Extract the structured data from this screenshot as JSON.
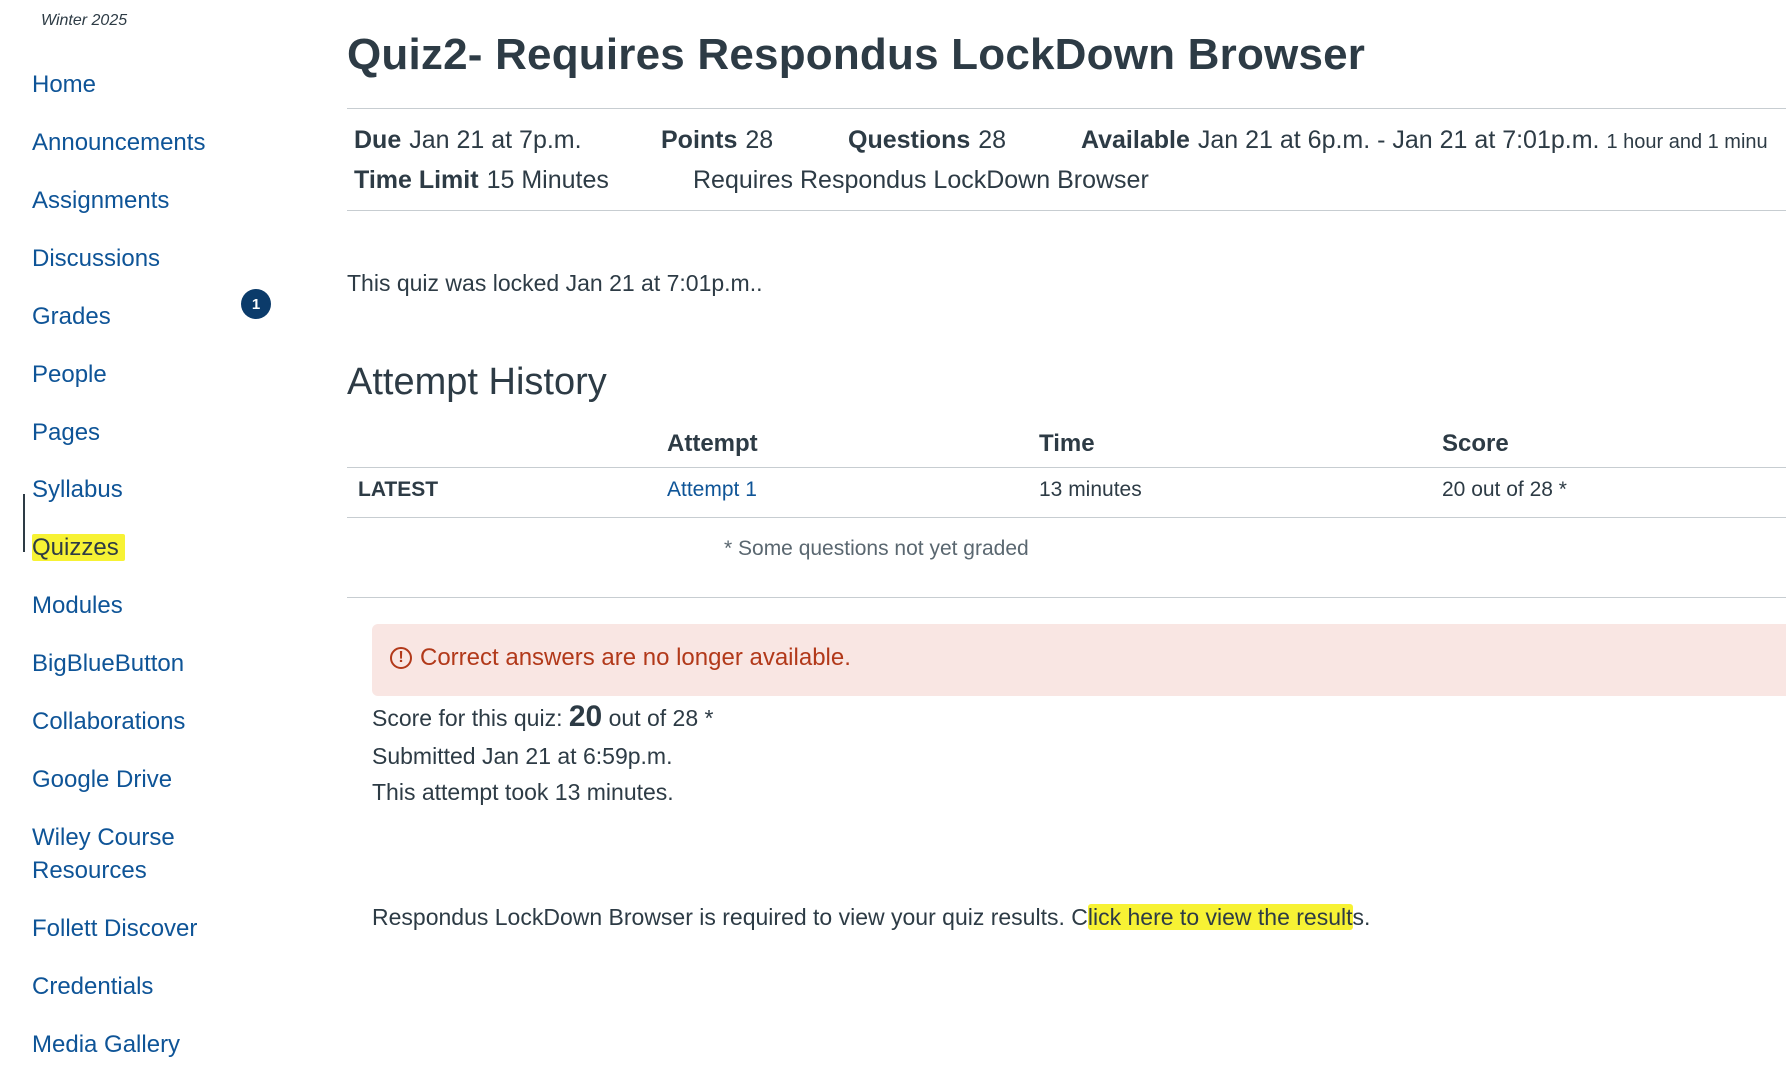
{
  "sidebar": {
    "term": "Winter 2025",
    "items": [
      {
        "label": "Home"
      },
      {
        "label": "Announcements"
      },
      {
        "label": "Assignments"
      },
      {
        "label": "Discussions"
      },
      {
        "label": "Grades",
        "badge": "1"
      },
      {
        "label": "People"
      },
      {
        "label": "Pages"
      },
      {
        "label": "Syllabus"
      },
      {
        "label": "Quizzes",
        "active": true
      },
      {
        "label": "Modules"
      },
      {
        "label": "BigBlueButton"
      },
      {
        "label": "Collaborations"
      },
      {
        "label": "Google Drive"
      },
      {
        "label": "Wiley Course",
        "label2": "Resources"
      },
      {
        "label": "Follett Discover"
      },
      {
        "label": "Credentials"
      },
      {
        "label": "Media Gallery"
      }
    ]
  },
  "quiz": {
    "title": "Quiz2- Requires Respondus LockDown Browser",
    "meta": {
      "due_label": "Due",
      "due_value": "Jan 21 at 7p.m.",
      "points_label": "Points",
      "points_value": "28",
      "questions_label": "Questions",
      "questions_value": "28",
      "available_label": "Available",
      "available_value": "Jan 21 at 6p.m. - Jan 21 at 7:01p.m.",
      "available_duration": "1 hour and 1 minu",
      "time_limit_label": "Time Limit",
      "time_limit_value": "15 Minutes",
      "requires": "Requires Respondus LockDown Browser"
    },
    "locked_message": "This quiz was locked Jan 21 at 7:01p.m..",
    "attempt_history": {
      "title": "Attempt History",
      "headers": {
        "attempt": "Attempt",
        "time": "Time",
        "score": "Score"
      },
      "row": {
        "tag": "LATEST",
        "attempt": "Attempt 1",
        "time": "13 minutes",
        "score": "20 out of 28 *"
      },
      "footnote": "* Some questions not yet graded"
    },
    "alert": {
      "icon": "warning-circle-icon",
      "symbol": "!",
      "text": "Correct answers are no longer available."
    },
    "score": {
      "prefix": "Score for this quiz:",
      "value": "20",
      "suffix": "out of 28 *"
    },
    "submitted": "Submitted Jan 21 at 6:59p.m.",
    "duration": "This attempt took 13 minutes.",
    "respondus": {
      "text": "Respondus LockDown Browser is required to view your quiz results.",
      "link_c": "C",
      "link_main": "lick here to view the result",
      "link_end": "s",
      "period": "."
    }
  },
  "colors": {
    "link": "#0e5497",
    "text": "#2d3b45",
    "badge": "#0b3b6a",
    "alert_bg": "#f9e6e3",
    "alert_text": "#b2391a",
    "highlight": "#f7f234"
  }
}
